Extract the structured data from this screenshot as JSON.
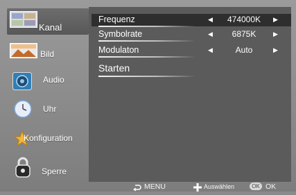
{
  "sidebar": {
    "items": [
      {
        "label": "Kanal",
        "icon": "tv-channel-icon",
        "active": true
      },
      {
        "label": "Bild",
        "icon": "picture-icon"
      },
      {
        "label": "Audio",
        "icon": "speaker-icon"
      },
      {
        "label": "Uhr",
        "icon": "clock-icon"
      },
      {
        "label": "Konfiguration",
        "icon": "star-icon"
      },
      {
        "label": "Sperre",
        "icon": "lock-icon"
      }
    ]
  },
  "panel": {
    "rows": [
      {
        "label": "Frequenz",
        "value": "474000K",
        "has_arrows": true,
        "selected": true
      },
      {
        "label": "Symbolrate",
        "value": "6875K",
        "has_arrows": true
      },
      {
        "label": "Modulaton",
        "value": "Auto",
        "has_arrows": true
      },
      {
        "label": "Starten",
        "value": "",
        "has_arrows": false
      }
    ]
  },
  "footer": {
    "menu_label": "MENU",
    "select_label": "Auswählen",
    "ok_key": "OK",
    "ok_label": "OK"
  },
  "colors": {
    "background": "#8a8a8a",
    "panel": "#5b5b5b",
    "selected_row": "#2e2e2e",
    "text": "#ffffff"
  }
}
